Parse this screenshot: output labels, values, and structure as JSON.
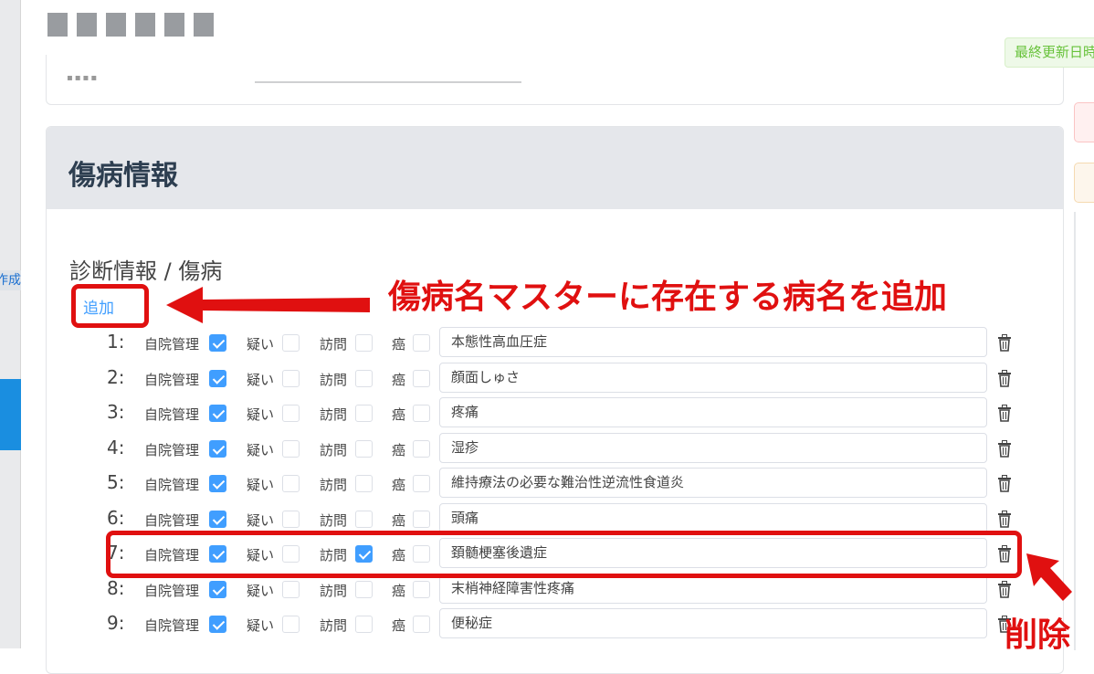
{
  "sidebar": {
    "partial_label": "作成"
  },
  "header": {
    "last_updated_badge": "最終更新日時"
  },
  "section": {
    "title": "傷病情報",
    "subtitle": "診断情報 / 傷病",
    "add_link": "追加",
    "labels": {
      "self": "自院管理",
      "suspect": "疑い",
      "visit": "訪問",
      "cancer": "癌"
    },
    "rows": [
      {
        "num": "1:",
        "self": true,
        "suspect": false,
        "visit": false,
        "cancer": false,
        "name": "本態性高血圧症"
      },
      {
        "num": "2:",
        "self": true,
        "suspect": false,
        "visit": false,
        "cancer": false,
        "name": "顔面しゅさ"
      },
      {
        "num": "3:",
        "self": true,
        "suspect": false,
        "visit": false,
        "cancer": false,
        "name": "疼痛"
      },
      {
        "num": "4:",
        "self": true,
        "suspect": false,
        "visit": false,
        "cancer": false,
        "name": "湿疹"
      },
      {
        "num": "5:",
        "self": true,
        "suspect": false,
        "visit": false,
        "cancer": false,
        "name": "維持療法の必要な難治性逆流性食道炎"
      },
      {
        "num": "6:",
        "self": true,
        "suspect": false,
        "visit": false,
        "cancer": false,
        "name": "頭痛"
      },
      {
        "num": "7:",
        "self": true,
        "suspect": false,
        "visit": true,
        "cancer": false,
        "name": "頚髄梗塞後遺症"
      },
      {
        "num": "8:",
        "self": true,
        "suspect": false,
        "visit": false,
        "cancer": false,
        "name": "末梢神経障害性疼痛"
      },
      {
        "num": "9:",
        "self": true,
        "suspect": false,
        "visit": false,
        "cancer": false,
        "name": "便秘症"
      }
    ]
  },
  "annotations": {
    "add_note": "傷病名マスターに存在する病名を追加",
    "delete_note": "削除",
    "color": "#e01010"
  }
}
